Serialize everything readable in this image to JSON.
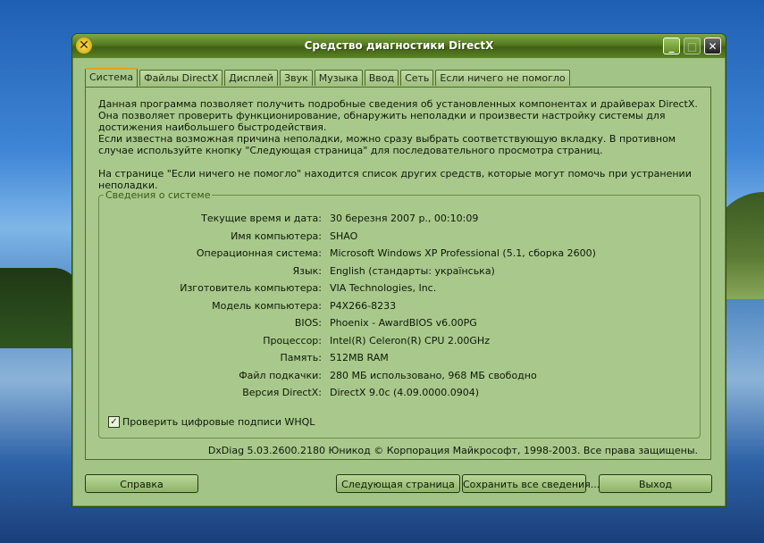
{
  "window": {
    "title": "Средство диагностики DirectX"
  },
  "titlebar": {
    "min": "_",
    "max": "□",
    "close": "✕"
  },
  "tabs": [
    {
      "label": "Система"
    },
    {
      "label": "Файлы DirectX"
    },
    {
      "label": "Дисплей"
    },
    {
      "label": "Звук"
    },
    {
      "label": "Музыка"
    },
    {
      "label": "Ввод"
    },
    {
      "label": "Сеть"
    },
    {
      "label": "Если ничего не помогло"
    }
  ],
  "intro": {
    "p1": "Данная программа позволяет получить подробные сведения об установленных компонентах и драйверах DirectX. Она позволяет проверить функционирование, обнаружить неполадки и произвести настройку системы для достижения наибольшего быстродействия.",
    "p2": "Если известна возможная причина неполадки, можно сразу выбрать соответствующую вкладку. В противном случае используйте кнопку \"Следующая страница\" для последовательного просмотра страниц.",
    "p3": "На странице \"Если ничего не помогло\" находится список других средств, которые могут помочь при устранении неполадки."
  },
  "sysinfo": {
    "title": "Сведения о системе",
    "rows": [
      {
        "label": "Текущие время и дата:",
        "value": "30 березня 2007 р., 00:10:09"
      },
      {
        "label": "Имя компьютера:",
        "value": "SHAO"
      },
      {
        "label": "Операционная система:",
        "value": "Microsoft Windows XP Professional (5.1, сборка 2600)"
      },
      {
        "label": "Язык:",
        "value": "English (стандарты: українська)"
      },
      {
        "label": "Изготовитель компьютера:",
        "value": "VIA Technologies, Inc."
      },
      {
        "label": "Модель компьютера:",
        "value": "P4X266-8233"
      },
      {
        "label": "BIOS:",
        "value": "Phoenix - AwardBIOS v6.00PG"
      },
      {
        "label": "Процессор:",
        "value": "Intel(R) Celeron(R) CPU 2.00GHz"
      },
      {
        "label": "Память:",
        "value": "512MB RAM"
      },
      {
        "label": "Файл подкачки:",
        "value": "280 МБ использовано, 968 МБ свободно"
      },
      {
        "label": "Версия DirectX:",
        "value": "DirectX 9.0c (4.09.0000.0904)"
      }
    ],
    "whql_label": "Проверить цифровые подписи WHQL",
    "whql_checked": "✓"
  },
  "copyright": "DxDiag 5.03.2600.2180 Юникод  © Корпорация Майкрософт, 1998-2003.  Все права защищены.",
  "buttons": {
    "help": "Справка",
    "next": "Следующая страница",
    "save": "Сохранить все сведения...",
    "exit": "Выход"
  }
}
